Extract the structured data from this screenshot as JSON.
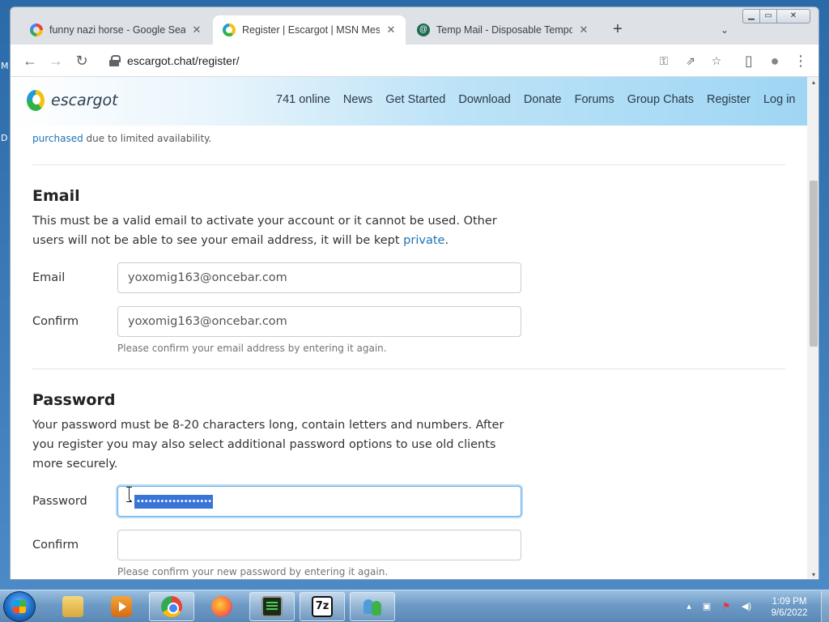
{
  "desktop": {
    "edge_letters": [
      "M",
      "D"
    ]
  },
  "browser": {
    "tabs": [
      {
        "title": "funny nazi horse - Google Search",
        "favicon": "google-icon",
        "active": false
      },
      {
        "title": "Register | Escargot | MSN Messen",
        "favicon": "escargot-icon",
        "active": true
      },
      {
        "title": "Temp Mail - Disposable Tempora",
        "favicon": "tempmail-icon",
        "active": false
      }
    ],
    "tab_close_glyph": "✕",
    "new_tab_glyph": "+",
    "tab_search_glyph": "⌄",
    "window_controls": {
      "minimize": "▁",
      "maximize": "▭",
      "close": "✕"
    },
    "toolbar": {
      "back": "←",
      "forward": "→",
      "reload": "↻",
      "url": "escargot.chat/register/",
      "key_icon": "⚿",
      "share_icon": "⇗",
      "star_icon": "☆",
      "sidepanel_icon": "▯",
      "profile_icon": "●",
      "menu_icon": "⋮"
    }
  },
  "site": {
    "logo_text": "escargot",
    "nav": [
      "741 online",
      "News",
      "Get Started",
      "Download",
      "Donate",
      "Forums",
      "Group Chats",
      "Register",
      "Log in"
    ]
  },
  "form": {
    "partial_line_link": "purchased",
    "partial_line_rest": " due to limited availability.",
    "email_section": {
      "title": "Email",
      "desc_before": "This must be a valid email to activate your account or it cannot be used. Other users will not be able to see your email address, it will be kept ",
      "desc_link": "private",
      "desc_after": ".",
      "email_label": "Email",
      "email_value": "yoxomig163@oncebar.com",
      "confirm_label": "Confirm",
      "confirm_value": "yoxomig163@oncebar.com",
      "help": "Please confirm your email address by entering it again."
    },
    "password_section": {
      "title": "Password",
      "desc": "Your password must be 8-20 characters long, contain letters and numbers. After you register you may also select additional password options to use old clients more securely.",
      "password_label": "Password",
      "password_dot": "•",
      "password_selected": "•••••••••••••••••••",
      "confirm_label": "Confirm",
      "confirm_value": "",
      "help": "Please confirm your new password by entering it again."
    }
  },
  "taskbar": {
    "apps": [
      "windows-explorer",
      "media-player",
      "chrome",
      "firefox",
      "terminal",
      "7-zip",
      "users"
    ],
    "seven_zip_label": "7z",
    "tray": {
      "up_arrow": "▴",
      "network": "▣",
      "flag": "⚑",
      "volume": "◀)"
    },
    "clock_time": "1:09 PM",
    "clock_date": "9/6/2022"
  },
  "colors": {
    "link": "#1a73b8",
    "selection": "#3875d7",
    "focus_ring": "#66afe9"
  }
}
